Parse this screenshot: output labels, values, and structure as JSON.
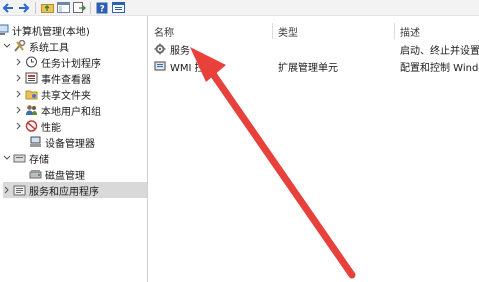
{
  "tree": {
    "root_label": "计算机管理(本地)",
    "system_tools_label": "系统工具",
    "task_scheduler_label": "任务计划程序",
    "event_viewer_label": "事件查看器",
    "shared_folders_label": "共享文件夹",
    "local_users_label": "本地用户和组",
    "performance_label": "性能",
    "device_manager_label": "设备管理器",
    "storage_label": "存储",
    "disk_management_label": "磁盘管理",
    "services_apps_label": "服务和应用程序"
  },
  "list": {
    "columns": [
      "名称",
      "类型",
      "描述"
    ],
    "rows": [
      {
        "name": "服务",
        "type": "",
        "desc": "启动、终止并设置"
      },
      {
        "name": "WMI 控件",
        "type": "扩展管理单元",
        "desc": "配置和控制 Windo"
      }
    ]
  },
  "colors": {
    "arrow": "#e8403a",
    "selection": "#d9d9d9"
  }
}
